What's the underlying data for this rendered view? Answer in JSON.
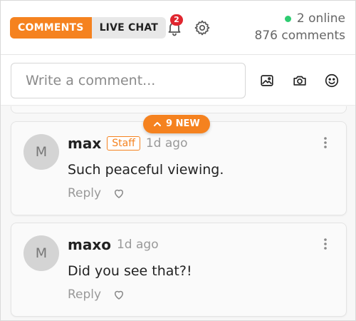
{
  "tabs": [
    {
      "label": "COMMENTS",
      "active": true
    },
    {
      "label": "LIVE CHAT",
      "active": false
    }
  ],
  "notifications": {
    "count": "2",
    "icon": "bell-icon"
  },
  "settings_icon": "gear-icon",
  "status": {
    "online": "2 online",
    "comments": "876 comments",
    "online_color": "#2ecc71"
  },
  "compose": {
    "placeholder": "Write a comment...",
    "value": "",
    "icons": [
      "image-icon",
      "camera-icon",
      "smiley-icon"
    ]
  },
  "new_pill": {
    "label": "9 NEW",
    "icon": "chevron-up-icon"
  },
  "comments": [
    {
      "avatar": "M",
      "author": "max",
      "badge": "Staff",
      "time": "1d ago",
      "text": "Such peaceful viewing.",
      "reply": "Reply"
    },
    {
      "avatar": "M",
      "author": "maxo",
      "badge": "",
      "time": "1d ago",
      "text": "Did you see that?!",
      "reply": "Reply"
    }
  ],
  "colors": {
    "accent": "#f5821f",
    "badge_red": "#e0262f"
  }
}
